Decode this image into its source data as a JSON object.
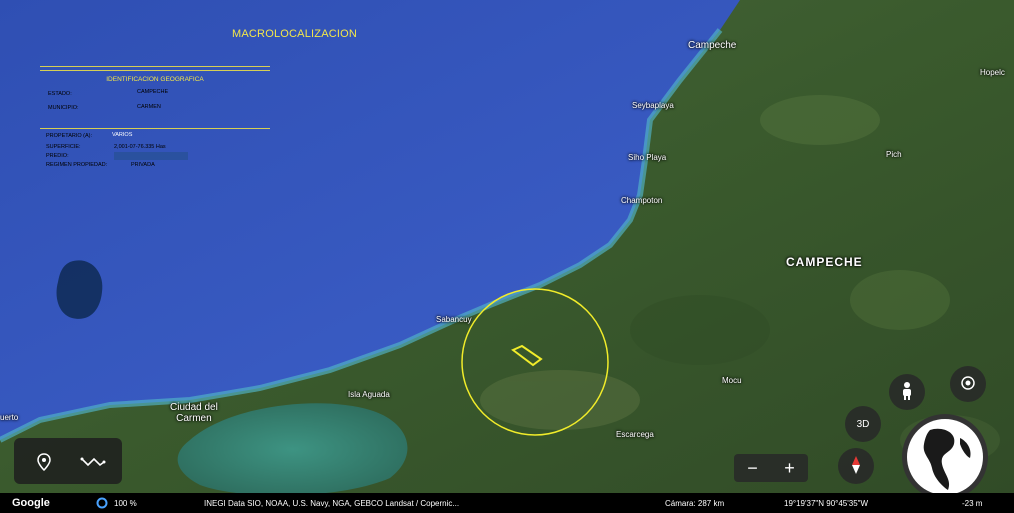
{
  "title": "MACROLOCALIZACION",
  "panel": {
    "heading": "IDENTIFICACION GEOGRAFICA",
    "estado_label": "ESTADO:",
    "estado_value": "CAMPECHE",
    "municipio_label": "MUNICIPIO:",
    "municipio_value": "CARMEN",
    "propietario_label": "PROPETARIO (A):",
    "propietario_value": "VARIOS",
    "superficie_label": "SUPERFICIE:",
    "superficie_value": "2,001-07-76.335 Has",
    "predio_label": "PREDIO:",
    "regimen_label": "REGIMEN PROPIEDAD:",
    "regimen_value": "PRIVADA"
  },
  "places": {
    "campeche_city": "Campeche",
    "seybaplaya": "Seybaplaya",
    "sihoplaya": "Siho Playa",
    "champoton": "Champoton",
    "campeche_state": "CAMPECHE",
    "pich": "Pich",
    "hopelchen": "Hopelc",
    "sabancuy": "Sabancuy",
    "isla_aguada": "Isla Aguada",
    "ciudad_del_carmen": "Ciudad del\nCarmen",
    "mocu": "Mocu",
    "escarcega": "Escarcega",
    "puerto": "uerto"
  },
  "controls": {
    "three_d": "3D",
    "zoom_out": "−",
    "zoom_in": "+"
  },
  "status": {
    "logo": "Google",
    "percent": "100 %",
    "attribution": "INEGI  Data SIO, NOAA, U.S. Navy, NGA, GEBCO  Landsat / Copernic...",
    "camera": "Cámara: 287 km",
    "coords": "19°19'37\"N 90°45'35\"W",
    "elevation": "-23 m"
  },
  "colors": {
    "label_yellow": "#f3e74a",
    "sea": "#3d57b8",
    "land": "#3b5a2e",
    "marker": "#f1ec2a"
  }
}
